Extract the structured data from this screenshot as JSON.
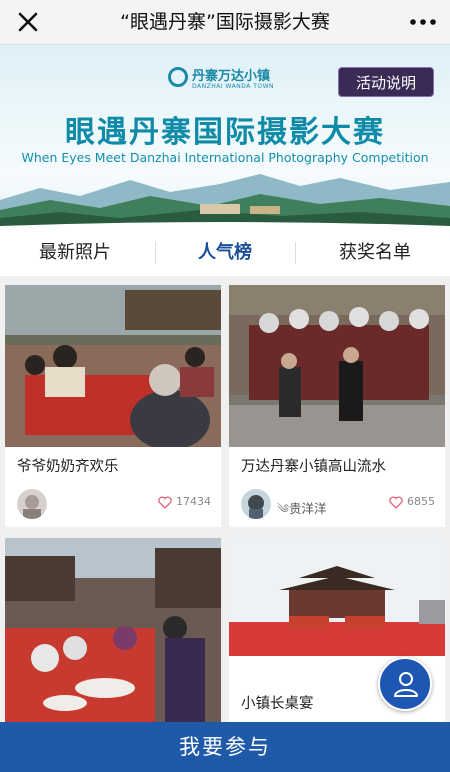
{
  "titlebar": {
    "title": "“眼遇丹寨”国际摄影大赛",
    "close_icon": "close-icon",
    "more_icon": "more-horizontal-icon"
  },
  "banner": {
    "brand_name": "丹寨万达小镇",
    "brand_sub": "DANZHAI WANDA TOWN",
    "rules_button": "活动说明",
    "headline": "眼遇丹寨国际摄影大赛",
    "subheadline": "When Eyes Meet Danzhai International Photography Competition"
  },
  "tabs": [
    {
      "label": "最新照片",
      "active": false
    },
    {
      "label": "人气榜",
      "active": true
    },
    {
      "label": "获奖名单",
      "active": false
    }
  ],
  "cards": [
    {
      "caption": "爷爷奶奶齐欢乐",
      "author": "",
      "likes": "17434"
    },
    {
      "caption": "万达丹寨小镇高山流水",
      "author": "贵洋洋",
      "likes": "6855"
    },
    {
      "caption": "",
      "author": "",
      "likes": ""
    },
    {
      "caption": "小镇长桌宴",
      "author": "",
      "likes": ""
    }
  ],
  "fab": {
    "icon": "user-icon"
  },
  "join_button": "我要参与",
  "colors": {
    "accent": "#1f5aa8",
    "headline": "#0f8aa7",
    "active_tab": "#1c4f9a",
    "rules_button_bg": "#3a2a55"
  }
}
